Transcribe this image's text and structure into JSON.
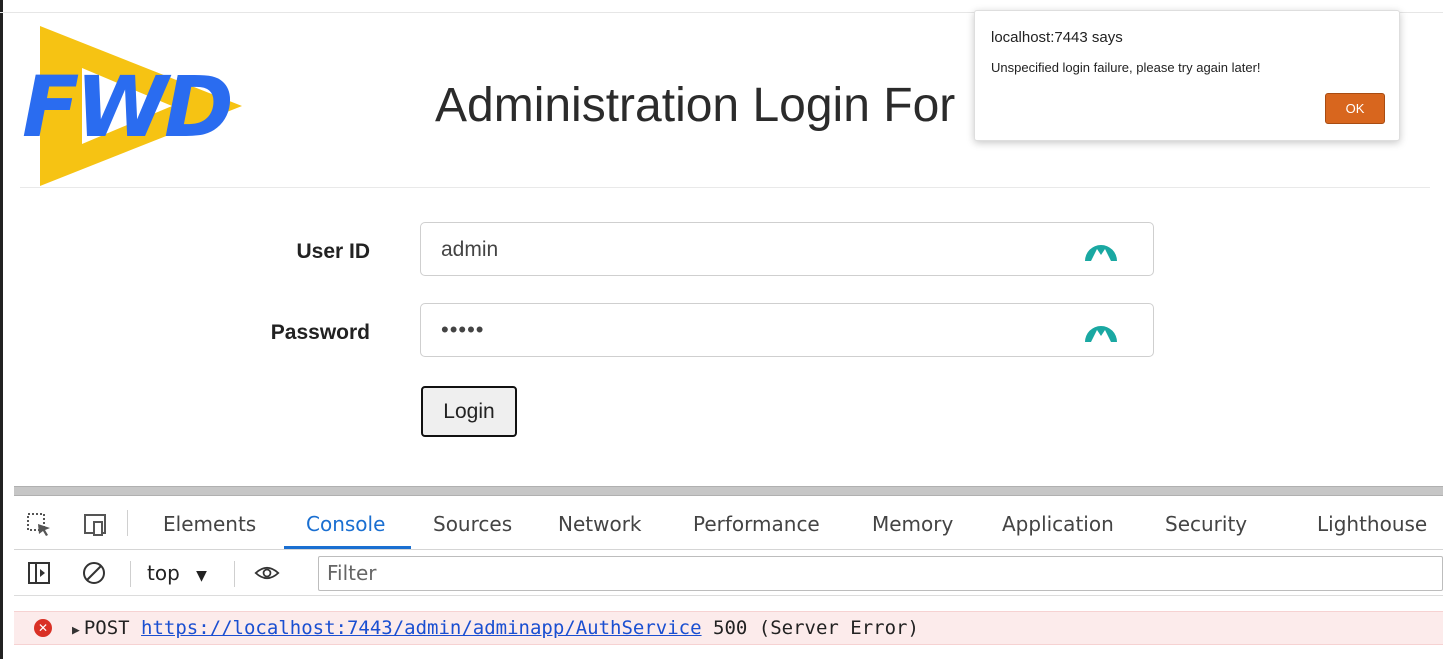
{
  "page": {
    "logo_text": "FWD",
    "title": "Administration Login For",
    "colors": {
      "logo_blue": "#2a6cf0",
      "logo_yellow": "#f6c313",
      "field_icon": "#1aa8a2"
    }
  },
  "form": {
    "userid_label": "User ID",
    "userid_value": "admin",
    "password_label": "Password",
    "password_value": "•••••",
    "login_label": "Login",
    "field_icon": "extension-mountain-icon"
  },
  "alert": {
    "title": "localhost:7443 says",
    "message": "Unspecified login failure, please try again later!",
    "ok_label": "OK",
    "ok_color": "#d8661e"
  },
  "devtools": {
    "tabs": [
      "Elements",
      "Console",
      "Sources",
      "Network",
      "Performance",
      "Memory",
      "Application",
      "Security",
      "Lighthouse"
    ],
    "active_tab": "Console",
    "accent": "#1a6fd1",
    "context": "top",
    "filter_placeholder": "Filter",
    "log": {
      "method": "POST",
      "url": "https://localhost:7443/admin/adminapp/AuthService",
      "status": "500 (Server Error)"
    }
  }
}
